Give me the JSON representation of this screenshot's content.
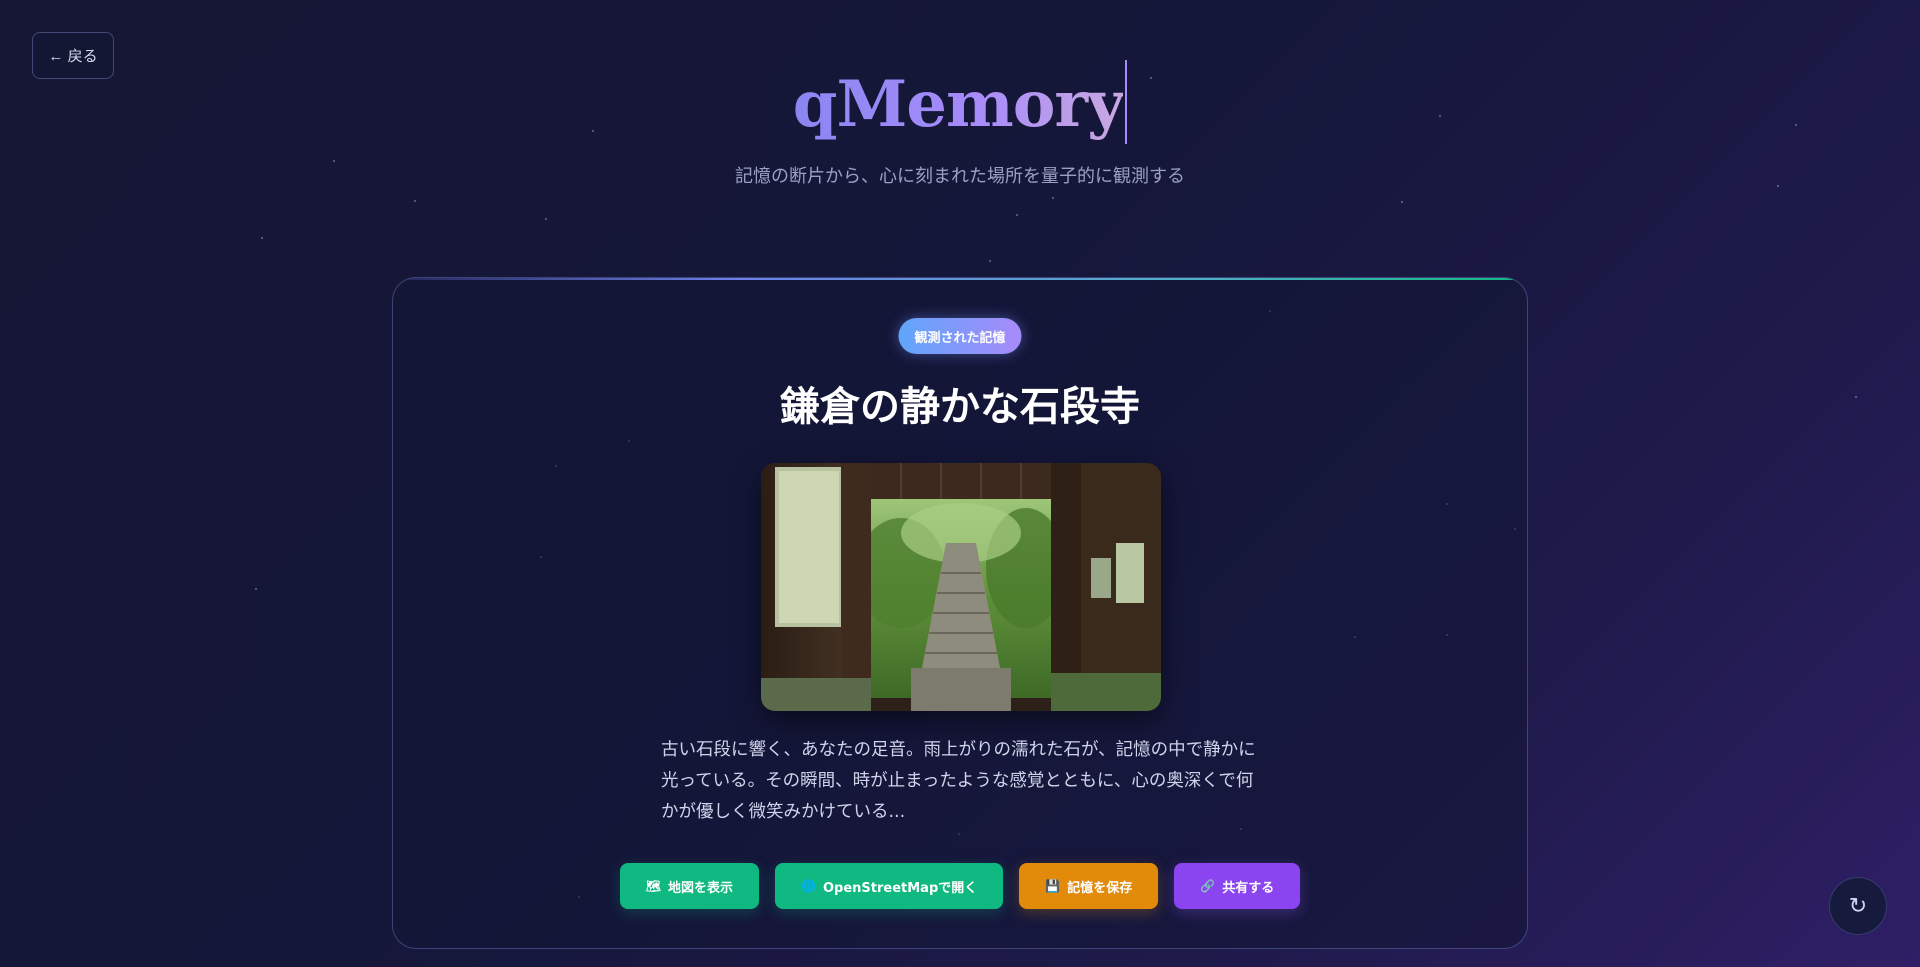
{
  "nav": {
    "back_label": "← 戻る"
  },
  "header": {
    "brand": "qMemory",
    "subtitle": "記憶の断片から、心に刻まれた場所を量子的に観測する"
  },
  "memory_card": {
    "badge": "観測された記憶",
    "title": "鎌倉の静かな石段寺",
    "photo_alt": "鎌倉の静かな石段寺",
    "description": "古い石段に響く、あなたの足音。雨上がりの濡れた石が、記憶の中で静かに光っている。その瞬間、時が止まったような感覚とともに、心の奥深くで何かが優しく微笑みかけている...",
    "actions": [
      {
        "icon": "map-icon",
        "glyph": "🗺",
        "label": "地図を表示",
        "color": "#10b981"
      },
      {
        "icon": "globe-icon",
        "glyph": "🌐",
        "label": "OpenStreetMapで開く",
        "color": "#10b981"
      },
      {
        "icon": "floppy-disk-icon",
        "glyph": "💾",
        "label": "記憶を保存",
        "color": "#e28b0b"
      },
      {
        "icon": "link-icon",
        "glyph": "🔗",
        "label": "共有する",
        "color": "#8b45f0"
      }
    ]
  },
  "floating": {
    "refresh_glyph": "↻",
    "icon": "refresh-icon"
  },
  "colors": {
    "accent_purple": "#a78bfa",
    "accent_blue": "#60a5fa",
    "accent_green": "#10b981"
  }
}
